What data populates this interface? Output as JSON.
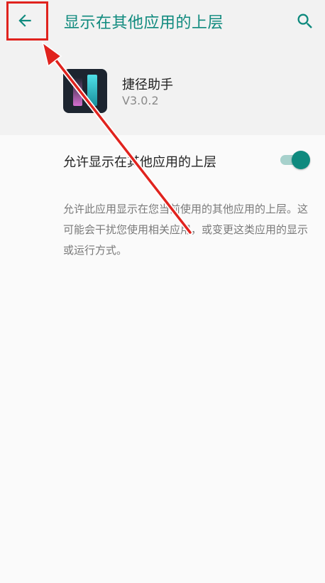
{
  "appbar": {
    "title": "显示在其他应用的上层",
    "back_icon": "arrow-back-icon",
    "search_icon": "search-icon",
    "accent": "#0f8a7e"
  },
  "app": {
    "name": "捷径助手",
    "version": "V3.0.2",
    "icon": "app-icon"
  },
  "setting": {
    "label": "允许显示在其他应用的上层",
    "enabled": true,
    "description": "允许此应用显示在您当前使用的其他应用的上层。这可能会干扰您使用相关应用，或变更这类应用的显示或运行方式。"
  },
  "annotation": {
    "highlight_color": "#e0231e"
  }
}
